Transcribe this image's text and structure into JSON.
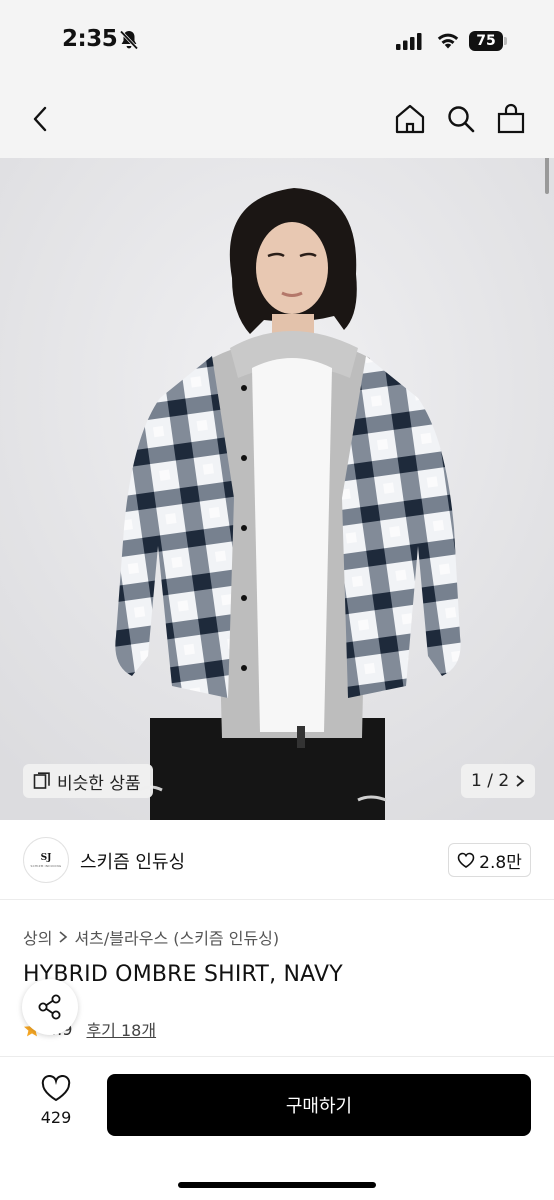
{
  "status_bar": {
    "time": "2:35",
    "battery": "75"
  },
  "nav": {
    "icons": [
      "back-icon",
      "home-icon",
      "search-icon",
      "bag-icon"
    ]
  },
  "hero": {
    "similar_label": "비슷한 상품",
    "pager": "1 / 2",
    "colors": {
      "background": "#e6e6e8",
      "shirt_dark": "#26344a",
      "shirt_light": "#f1f3f6",
      "hoodie": "#bcbcbc"
    }
  },
  "shop": {
    "logo_text": "SJ",
    "logo_subtext": "SCHIZM INDUCING",
    "name": "스키즘 인듀싱",
    "likes": "2.8만"
  },
  "product": {
    "breadcrumb": [
      "상의",
      "셔츠/블라우스 (스키즘 인듀싱)"
    ],
    "title": "HYBRID OMBRE SHIRT, NAVY",
    "rating": "4.9",
    "reviews": "후기 18개"
  },
  "bottom": {
    "wish_count": "429",
    "buy_label": "구매하기",
    "accent": "#000000"
  }
}
